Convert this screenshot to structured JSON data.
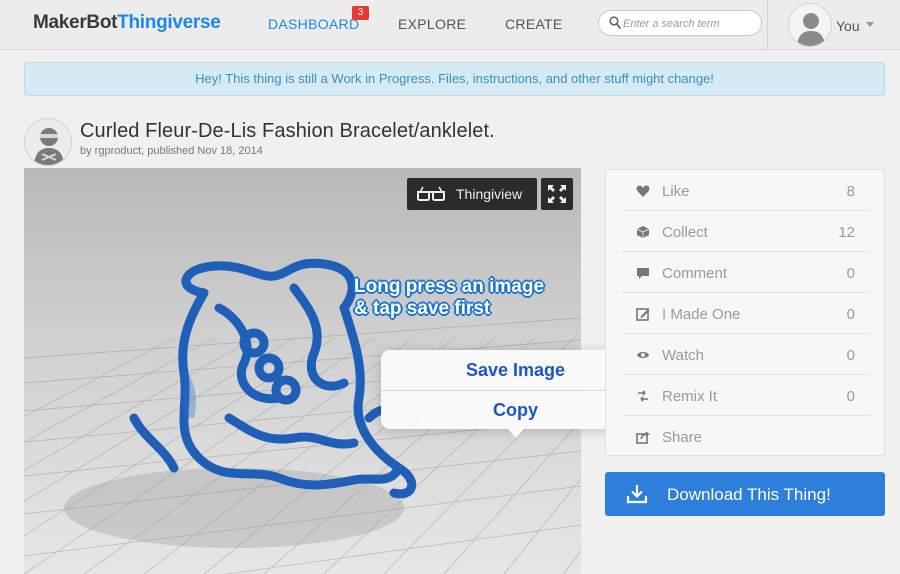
{
  "nav": {
    "logo_part1": "MakerBot",
    "logo_part2": "Thingiverse",
    "dashboard": "DASHBOARD",
    "dashboard_badge": "3",
    "explore": "EXPLORE",
    "create": "CREATE",
    "search_placeholder": "Enter a search term",
    "user_label": "You"
  },
  "banner": {
    "text": "Hey! This thing is still a Work in Progress. Files, instructions, and other stuff might change!"
  },
  "thing": {
    "title": "Curled Fleur-De-Lis Fashion Bracelet/anklelet.",
    "byline": "by rgproduct, published Nov 18, 2014"
  },
  "viewer": {
    "thingiview_label": "Thingiview",
    "overlay_line1": "Long press an image",
    "overlay_line2": "& tap save first"
  },
  "context_menu": {
    "save_image": "Save Image",
    "copy": "Copy"
  },
  "stats": [
    {
      "label": "Like",
      "value": "8",
      "icon": "heart-icon"
    },
    {
      "label": "Collect",
      "value": "12",
      "icon": "collect-icon"
    },
    {
      "label": "Comment",
      "value": "0",
      "icon": "comment-icon"
    },
    {
      "label": "I Made One",
      "value": "0",
      "icon": "made-one-icon"
    },
    {
      "label": "Watch",
      "value": "0",
      "icon": "watch-icon"
    },
    {
      "label": "Remix It",
      "value": "0",
      "icon": "remix-icon"
    },
    {
      "label": "Share",
      "value": "",
      "icon": "share-icon"
    }
  ],
  "download": {
    "label": "Download This Thing!"
  },
  "colors": {
    "accent": "#1e88e5",
    "download_bg": "#2e7fdc",
    "badge_bg": "#e53935",
    "banner_bg": "#d6eaf3",
    "bracelet": "#1f5fb8"
  }
}
